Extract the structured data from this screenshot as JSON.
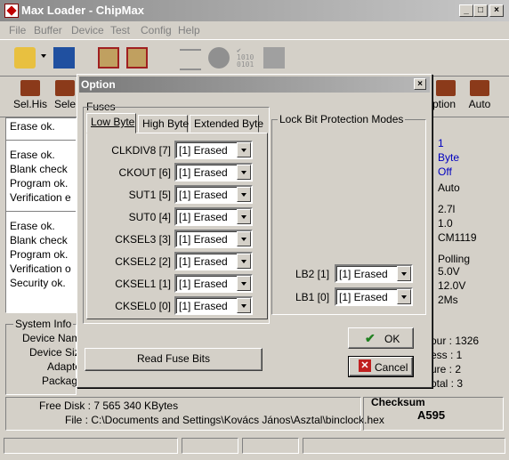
{
  "window": {
    "title": "Max Loader - ChipMax"
  },
  "menu": [
    "File",
    "Buffer",
    "Device",
    "Test",
    "Config",
    "Help"
  ],
  "toolbar2": {
    "selhis": "Sel.His",
    "sele": "Sele",
    "option": "Option",
    "auto": "Auto"
  },
  "log": {
    "lines_a": [
      "Erase ok."
    ],
    "lines_b": [
      "Erase ok.",
      "Blank check",
      "Program ok.",
      "Verification e"
    ],
    "lines_c": [
      "Erase ok.",
      "Blank check",
      "Program ok.",
      "Verification o",
      "Security ok."
    ]
  },
  "right_values": [
    "1",
    "Byte",
    "Off",
    "Auto",
    "2.7l",
    "1.0",
    "CM1119",
    "Polling",
    "5.0V",
    "12.0V",
    "2Ms"
  ],
  "sysinfo": {
    "legend": "System Info",
    "rows": [
      "Device Nam",
      "Device Siz",
      "Adapte",
      "Packag"
    ]
  },
  "right_info": [
    "our : 1326",
    "ess : 1",
    "ure : 2",
    "otal : 3"
  ],
  "file": {
    "free_disk": "Free Disk : 7 565 340 KBytes",
    "path": "File : C:\\Documents and Settings\\Kovács János\\Asztal\\binclock.hex"
  },
  "checksum": {
    "label": "Checksum",
    "value": "A595"
  },
  "dialog": {
    "title": "Option",
    "fuses_label": "Fuses",
    "tabs": [
      "Low Byte",
      "High Byte",
      "Extended Byte"
    ],
    "fuses": [
      {
        "label": "CLKDIV8 [7]",
        "value": "[1] Erased"
      },
      {
        "label": "CKOUT [6]",
        "value": "[1] Erased"
      },
      {
        "label": "SUT1 [5]",
        "value": "[1] Erased"
      },
      {
        "label": "SUT0 [4]",
        "value": "[1] Erased"
      },
      {
        "label": "CKSEL3 [3]",
        "value": "[1] Erased"
      },
      {
        "label": "CKSEL2 [2]",
        "value": "[1] Erased"
      },
      {
        "label": "CKSEL1 [1]",
        "value": "[1] Erased"
      },
      {
        "label": "CKSEL0 [0]",
        "value": "[1] Erased"
      }
    ],
    "lock_group": "Lock Bit Protection Modes",
    "locks": [
      {
        "label": "LB2 [1]",
        "value": "[1] Erased"
      },
      {
        "label": "LB1 [0]",
        "value": "[1] Erased"
      }
    ],
    "ok_label": "OK",
    "cancel_label": "Cancel",
    "read_fuse_label": "Read Fuse Bits"
  }
}
